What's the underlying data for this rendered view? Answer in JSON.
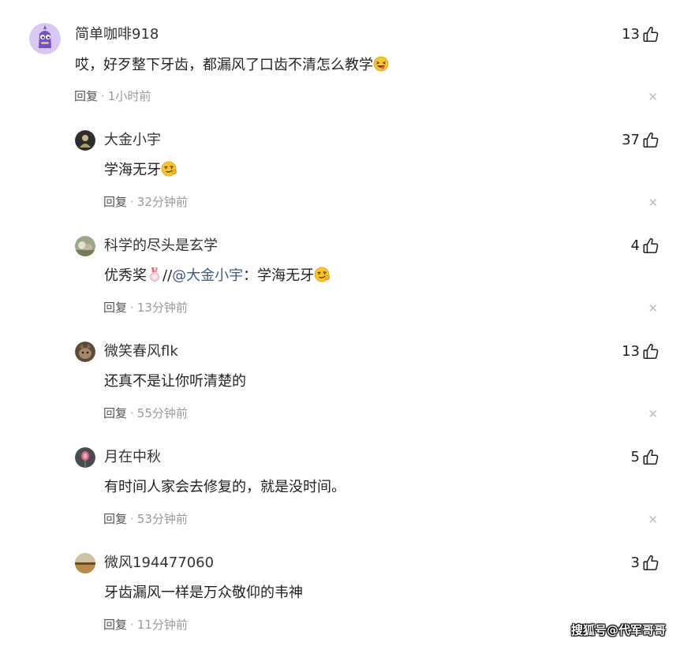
{
  "colors": {
    "mention": "#3d5a8a",
    "meta_time": "#9a9a9a",
    "close": "#bdbdbd"
  },
  "comments": [
    {
      "username": "简单咖啡918",
      "text": "哎，好歹整下牙齿，都漏风了口齿不清怎么教学",
      "emoji": "laughing-tongue-emoji",
      "reply_label": "回复",
      "time": "1小时前",
      "likes": "13",
      "avatar_icon": "purple-cartoon-avatar"
    },
    {
      "username": "大金小宇",
      "text": "学海无牙",
      "emoji": "smirk-emoji",
      "reply_label": "回复",
      "time": "32分钟前",
      "likes": "37",
      "avatar_icon": "buddha-avatar"
    },
    {
      "username": "科学的尽头是玄学",
      "text_before": "优秀奖",
      "text_after": "//",
      "mention": "@大金小宇",
      "quote": "：学海无牙",
      "emoji_inline": "medal-emoji",
      "emoji": "smirk-emoji",
      "reply_label": "回复",
      "time": "13分钟前",
      "likes": "4",
      "avatar_icon": "photo-avatar"
    },
    {
      "username": "微笑春风flk",
      "text": "还真不是让你听清楚的",
      "reply_label": "回复",
      "time": "55分钟前",
      "likes": "13",
      "avatar_icon": "cat-avatar"
    },
    {
      "username": "月在中秋",
      "text": "有时间人家会去修复的，就是没时间。",
      "reply_label": "回复",
      "time": "53分钟前",
      "likes": "5",
      "avatar_icon": "flower-avatar"
    },
    {
      "username": "微风194477060",
      "text": "牙齿漏风一样是万众敬仰的韦神",
      "reply_label": "回复",
      "time": "11分钟前",
      "likes": "3",
      "avatar_icon": "landscape-avatar"
    }
  ],
  "watermark": "搜狐号@代军哥哥"
}
